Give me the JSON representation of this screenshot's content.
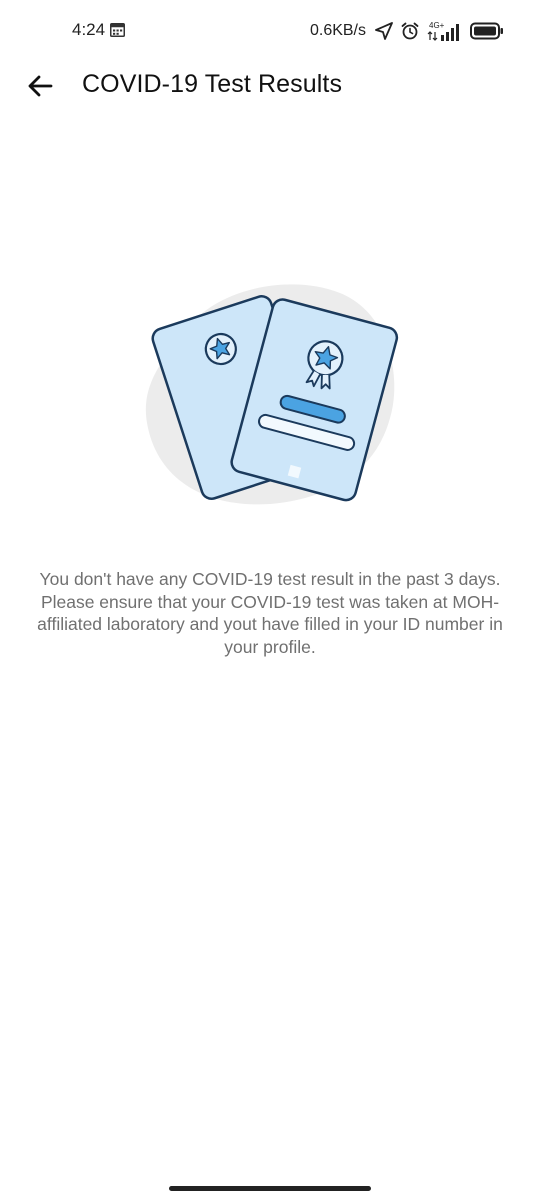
{
  "status_bar": {
    "time": "4:24",
    "network_speed": "0.6KB/s",
    "network_type": "4G+",
    "icons": [
      "calendar-icon",
      "location-arrow-icon",
      "alarm-icon",
      "signal-icon",
      "battery-icon"
    ]
  },
  "header": {
    "title": "COVID-19 Test Results",
    "back_icon": "arrow-left-icon"
  },
  "empty_state": {
    "illustration": "certificate-cards-illustration",
    "message": "You don't have any COVID-19 test result in the past 3 days. Please ensure that your COVID-19 test was taken at MOH-affiliated laboratory and yout have filled in your ID number in your profile."
  },
  "colors": {
    "background": "#ffffff",
    "card_fill": "#cde6f9",
    "card_outline": "#1b3a5c",
    "accent_blue": "#4ba3e2",
    "blob": "#ececec",
    "message_text": "#707070"
  }
}
